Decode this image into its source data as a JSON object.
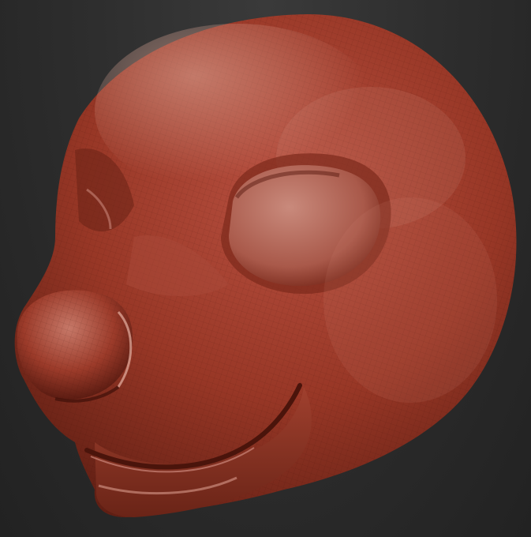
{
  "scene": {
    "subject": "sculpted-head",
    "background_top": "#3a3a3a",
    "background_bottom": "#1f1f1f",
    "material": {
      "base": "#9b3a2a",
      "shadow": "#5a1d12",
      "highlight": "#d59a8a",
      "rim": "#c86a55"
    }
  }
}
